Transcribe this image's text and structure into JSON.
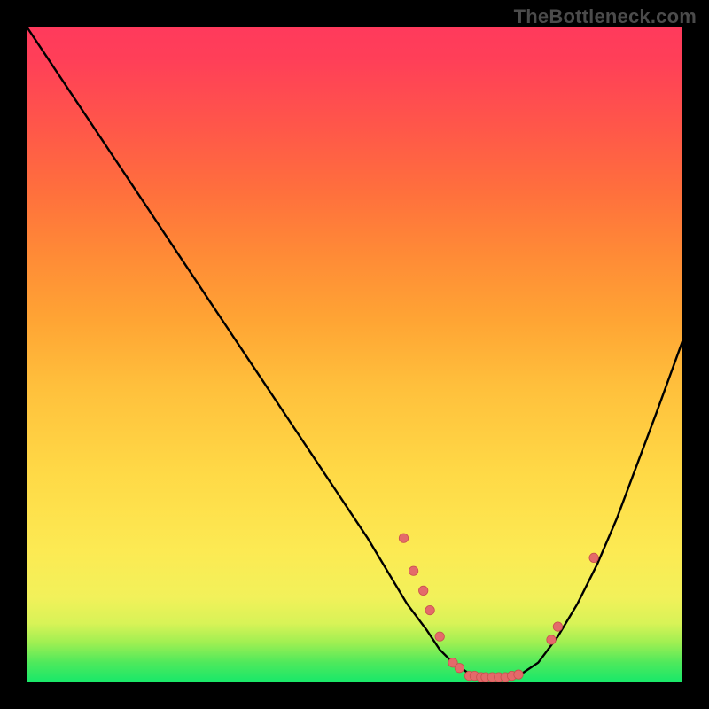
{
  "watermark": "TheBottleneck.com",
  "colors": {
    "curve": "#000000",
    "marker_fill": "#e46a6a",
    "marker_stroke": "#c94f4f"
  },
  "chart_data": {
    "type": "line",
    "title": "",
    "xlabel": "",
    "ylabel": "",
    "xlim": [
      0,
      100
    ],
    "ylim": [
      0,
      100
    ],
    "curve": {
      "x": [
        0,
        4,
        8,
        12,
        16,
        20,
        24,
        28,
        32,
        36,
        40,
        44,
        48,
        52,
        55,
        58,
        61,
        63,
        65,
        68,
        70,
        72,
        75,
        78,
        81,
        84,
        87,
        90,
        93,
        96,
        100
      ],
      "y": [
        100,
        94,
        88,
        82,
        76,
        70,
        64,
        58,
        52,
        46,
        40,
        34,
        28,
        22,
        17,
        12,
        8,
        5,
        3,
        1,
        0.5,
        0.5,
        1,
        3,
        7,
        12,
        18,
        25,
        33,
        41,
        52
      ]
    },
    "markers": [
      {
        "x": 57.5,
        "y": 22
      },
      {
        "x": 59.0,
        "y": 17
      },
      {
        "x": 60.5,
        "y": 14
      },
      {
        "x": 61.5,
        "y": 11
      },
      {
        "x": 63.0,
        "y": 7
      },
      {
        "x": 65.0,
        "y": 3
      },
      {
        "x": 66.0,
        "y": 2.2
      },
      {
        "x": 67.5,
        "y": 1.0
      },
      {
        "x": 68.3,
        "y": 1.0
      },
      {
        "x": 69.3,
        "y": 0.8
      },
      {
        "x": 70.0,
        "y": 0.8
      },
      {
        "x": 71.0,
        "y": 0.8
      },
      {
        "x": 72.0,
        "y": 0.8
      },
      {
        "x": 73.0,
        "y": 0.8
      },
      {
        "x": 74.0,
        "y": 1.0
      },
      {
        "x": 75.0,
        "y": 1.2
      },
      {
        "x": 80.0,
        "y": 6.5
      },
      {
        "x": 81.0,
        "y": 8.5
      },
      {
        "x": 86.5,
        "y": 19
      }
    ],
    "marker_radius": 5.2
  }
}
